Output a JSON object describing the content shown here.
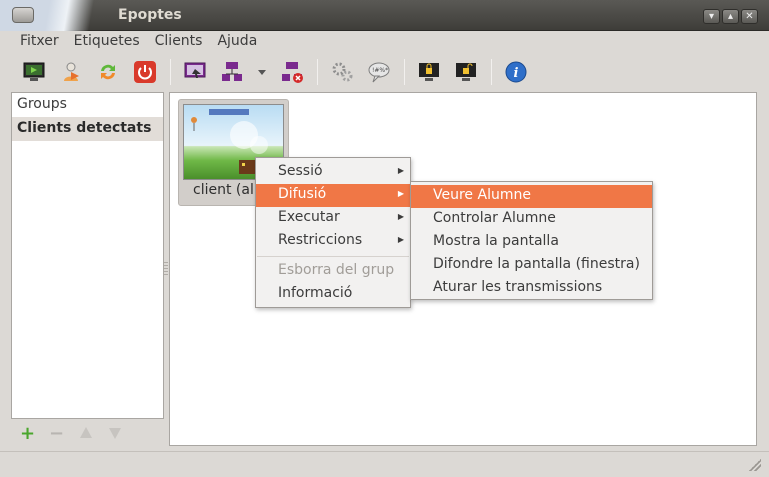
{
  "window": {
    "title": "Epoptes"
  },
  "menubar": [
    "Fitxer",
    "Etiquetes",
    "Clients",
    "Ajuda"
  ],
  "toolbar": {
    "icons": [
      "monitor-arrow-icon",
      "user-logout-icon",
      "refresh-icon",
      "power-icon",
      "broadcast-icon",
      "broadcast-window-icon",
      "dropdown-arrow-icon",
      "stop-broadcast-icon",
      "execute-gears-icon",
      "message-icon",
      "lock-screen-icon",
      "unlock-screen-icon",
      "info-icon"
    ]
  },
  "sidebar": {
    "groups_label": "Groups",
    "detected_label": "Clients detectats"
  },
  "client": {
    "label": "client (alu"
  },
  "context_menu": {
    "items": [
      "Sessió",
      "Difusió",
      "Executar",
      "Restriccions"
    ],
    "disabled_item": "Esborra del grup",
    "info_item": "Informació"
  },
  "submenu": {
    "items": [
      "Veure Alumne",
      "Controlar Alumne",
      "Mostra la pantalla",
      "Difondre la pantalla (finestra)",
      "Aturar les transmissions"
    ]
  },
  "colors": {
    "highlight": "#f07746",
    "titlebar": "#3e3d39"
  }
}
